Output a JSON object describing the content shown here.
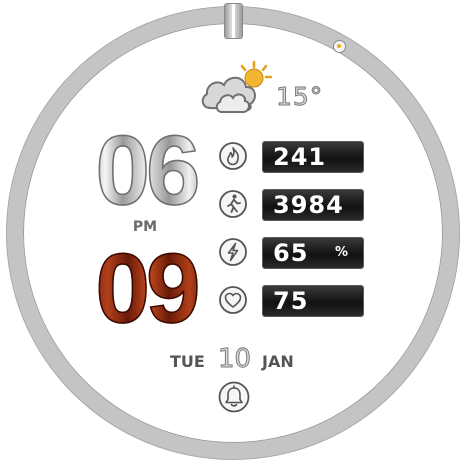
{
  "weather": {
    "temperature": "15°",
    "icon": "partly-cloudy-icon"
  },
  "time": {
    "hour": "06",
    "minute": "09",
    "ampm": "PM"
  },
  "stats": {
    "calories": {
      "value": "241",
      "icon": "calories-flame-icon"
    },
    "steps": {
      "value": "3984",
      "icon": "walking-person-icon"
    },
    "battery": {
      "value": "65",
      "unit": "%",
      "icon": "lightning-bolt-icon"
    },
    "heart_rate": {
      "value": "75",
      "icon": "heart-icon"
    }
  },
  "date": {
    "weekday": "TUE",
    "day": "10",
    "month": "JAN"
  },
  "alarm": {
    "icon": "alarm-bell-icon"
  },
  "colors": {
    "hour_silver": "#c8c8c8",
    "minute_copper": "#8a2a0e",
    "bezel": "#c4c4c4",
    "stat_box": "#1a1a1a"
  }
}
